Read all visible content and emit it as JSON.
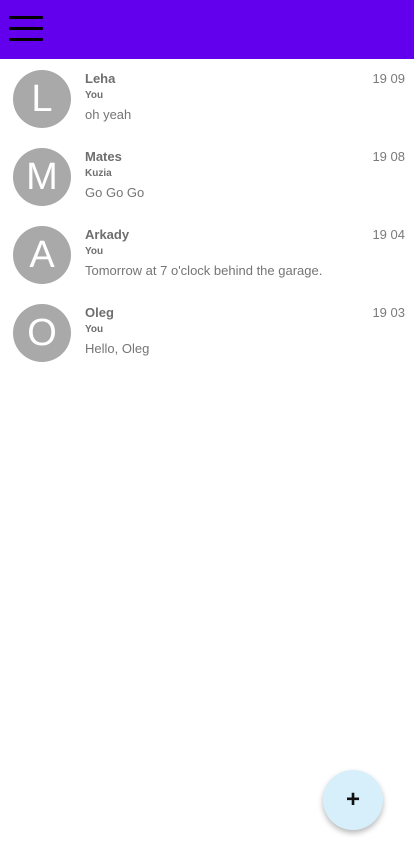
{
  "appbar": {
    "background": "#6200ee",
    "menu_icon": "hamburger-menu-icon"
  },
  "chats": [
    {
      "initial": "L",
      "name": "Leha",
      "sender": "You",
      "message": "oh yeah",
      "time": "19 09"
    },
    {
      "initial": "M",
      "name": "Mates",
      "sender": "Kuzia",
      "message": "Go Go Go",
      "time": "19 08"
    },
    {
      "initial": "A",
      "name": "Arkady",
      "sender": "You",
      "message": "Tomorrow at 7 o'clock behind the garage.",
      "time": "19 04"
    },
    {
      "initial": "O",
      "name": "Oleg",
      "sender": "You",
      "message": "Hello, Oleg",
      "time": "19 03"
    }
  ],
  "fab": {
    "icon": "plus-icon",
    "symbol": "+",
    "background": "#d6effa"
  },
  "colors": {
    "avatar_bg": "#a9a9a9",
    "text_gray": "#6e6e6e"
  }
}
